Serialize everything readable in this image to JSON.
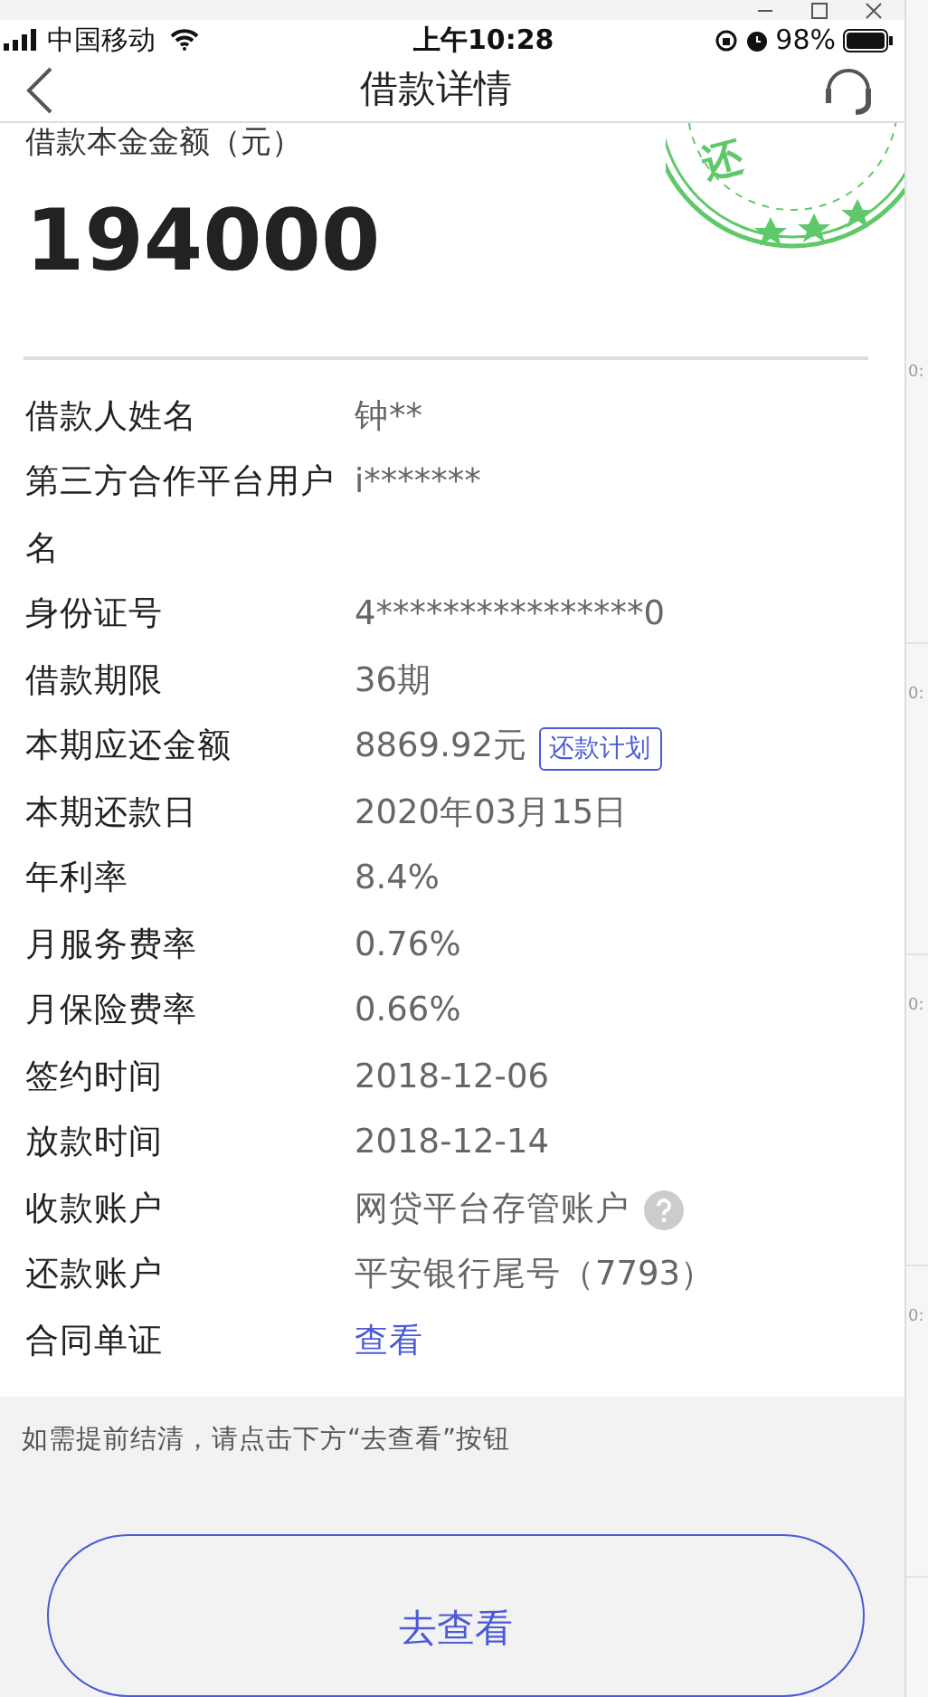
{
  "status_bar": {
    "carrier": "中国移动",
    "time": "上午10:28",
    "battery": "98%"
  },
  "nav": {
    "title": "借款详情"
  },
  "principal": {
    "label": "借款本金金额（元）",
    "amount": "194000",
    "stamp_text": "还"
  },
  "details": [
    {
      "label": "借款人姓名",
      "value": "钟**",
      "kind": "text"
    },
    {
      "label": "第三方合作平台用户名",
      "value": "i*******",
      "kind": "text"
    },
    {
      "label": "身份证号",
      "value": "4****************0",
      "kind": "text"
    },
    {
      "label": "借款期限",
      "value": "36期",
      "kind": "text"
    },
    {
      "label": "本期应还金额",
      "value": "8869.92元",
      "kind": "text",
      "button": "还款计划"
    },
    {
      "label": "本期还款日",
      "value": "2020年03月15日",
      "kind": "text"
    },
    {
      "label": "年利率",
      "value": "8.4%",
      "kind": "text"
    },
    {
      "label": "月服务费率",
      "value": "0.76%",
      "kind": "text"
    },
    {
      "label": "月保险费率",
      "value": "0.66%",
      "kind": "text"
    },
    {
      "label": "签约时间",
      "value": "2018-12-06",
      "kind": "text"
    },
    {
      "label": "放款时间",
      "value": "2018-12-14",
      "kind": "text"
    },
    {
      "label": "收款账户",
      "value": "网贷平台存管账户",
      "kind": "help"
    },
    {
      "label": "还款账户",
      "value": "平安银行尾号（7793）",
      "kind": "text"
    },
    {
      "label": "合同单证",
      "value": "查看",
      "kind": "link"
    }
  ],
  "footer": {
    "note": "如需提前结清，请点击下方“去查看”按钮",
    "button": "去查看"
  },
  "side_panel": {
    "times": [
      "0:",
      "0:",
      "0:",
      "0:"
    ]
  }
}
